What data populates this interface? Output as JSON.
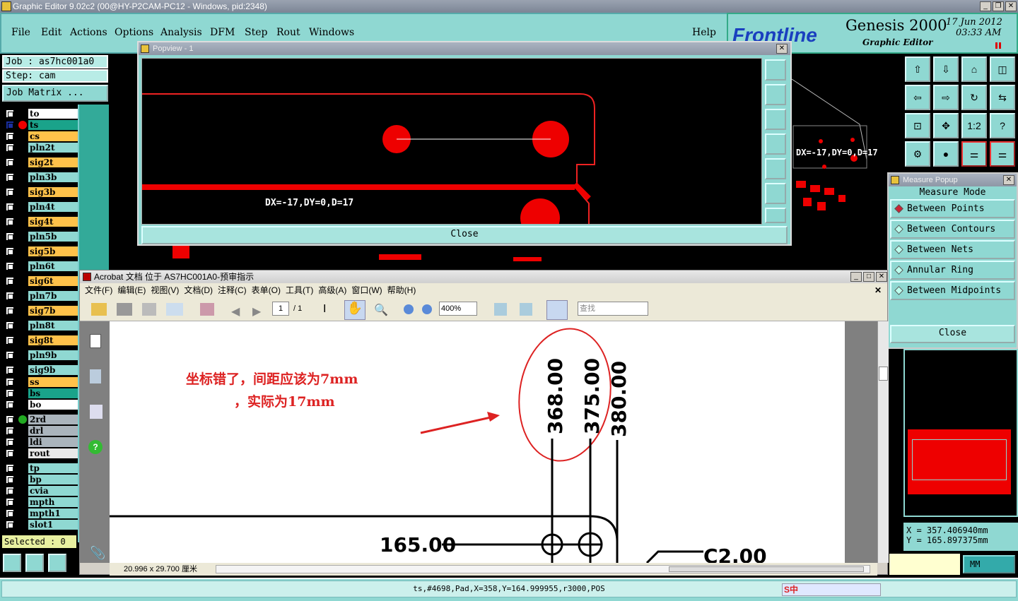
{
  "window": {
    "title": "Graphic Editor 9.02c2 (00@HY-P2CAM-PC12 - Windows, pid:2348)"
  },
  "menu": {
    "items": [
      "File",
      "Edit",
      "Actions",
      "Options",
      "Analysis",
      "DFM",
      "Step",
      "Rout",
      "Windows"
    ],
    "help": "Help"
  },
  "brand": {
    "logo": "Frontline",
    "product": "Genesis 2000",
    "subtitle": "Graphic Editor",
    "date": "17 Jun 2012",
    "time": "03:33 AM"
  },
  "job": {
    "job_label": "Job : as7hc001a0",
    "step_label": "Step: cam",
    "matrix_button": "Job Matrix ..."
  },
  "layers": [
    {
      "name": "to",
      "color": "#ffffff"
    },
    {
      "name": "ts",
      "color": "#1aa38a"
    },
    {
      "name": "cs",
      "color": "#ffc24a"
    },
    {
      "name": "pln2t",
      "color": "#8fd8d2"
    },
    {
      "name": "sig2t",
      "color": "#ffc24a"
    },
    {
      "name": "pln3b",
      "color": "#8fd8d2"
    },
    {
      "name": "sig3b",
      "color": "#ffc24a"
    },
    {
      "name": "pln4t",
      "color": "#8fd8d2"
    },
    {
      "name": "sig4t",
      "color": "#ffc24a"
    },
    {
      "name": "pln5b",
      "color": "#8fd8d2"
    },
    {
      "name": "sig5b",
      "color": "#ffc24a"
    },
    {
      "name": "pln6t",
      "color": "#8fd8d2"
    },
    {
      "name": "sig6t",
      "color": "#ffc24a"
    },
    {
      "name": "pln7b",
      "color": "#8fd8d2"
    },
    {
      "name": "sig7b",
      "color": "#ffc24a"
    },
    {
      "name": "pln8t",
      "color": "#8fd8d2"
    },
    {
      "name": "sig8t",
      "color": "#ffc24a"
    },
    {
      "name": "pln9b",
      "color": "#8fd8d2"
    },
    {
      "name": "sig9b",
      "color": "#8fd8d2"
    },
    {
      "name": "ss",
      "color": "#ffc24a"
    },
    {
      "name": "bs",
      "color": "#1aa38a"
    },
    {
      "name": "bo",
      "color": "#ffffff"
    },
    {
      "name": "2rd",
      "color": "#aab4bc"
    },
    {
      "name": "drl",
      "color": "#aab4bc"
    },
    {
      "name": "ldi",
      "color": "#aab4bc"
    },
    {
      "name": "rout",
      "color": "#e8e8e8"
    },
    {
      "name": "tp",
      "color": "#8fd8d2"
    },
    {
      "name": "bp",
      "color": "#8fd8d2"
    },
    {
      "name": "cvia",
      "color": "#8fd8d2"
    },
    {
      "name": "mpth",
      "color": "#8fd8d2"
    },
    {
      "name": "mpth1",
      "color": "#8fd8d2"
    },
    {
      "name": "slot1",
      "color": "#8fd8d2"
    }
  ],
  "selected": "Selected : 0",
  "popview": {
    "title": "Popview - 1",
    "measure_text": "DX=-17,DY=0,D=17",
    "close": "Close"
  },
  "canvas_label": "DX=-17,DY=0,D=17",
  "measure_popup": {
    "title": "Measure Popup",
    "mode_label": "Measure Mode",
    "options": [
      "Between Points",
      "Between Contours",
      "Between Nets",
      "Annular Ring",
      "Between Midpoints"
    ],
    "close": "Close"
  },
  "coords": {
    "x": "X  = 357.406940mm",
    "y": "Y  = 165.897375mm",
    "unit": "MM"
  },
  "acrobat": {
    "title": "Acrobat 文档 位于 AS7HC001A0-预审指示",
    "menu": [
      "文件(F)",
      "编辑(E)",
      "视图(V)",
      "文档(D)",
      "注释(C)",
      "表单(O)",
      "工具(T)",
      "高级(A)",
      "窗口(W)",
      "帮助(H)"
    ],
    "page": "1",
    "pages": "/ 1",
    "zoom": "400%",
    "search": "查找",
    "page_size": "20.996 x 29.700 厘米"
  },
  "drawing": {
    "note_line1": "坐标错了，间距应该为7mm",
    "note_line2": "，实际为17mm",
    "labels": [
      "368.00",
      "375.00",
      "380.00"
    ],
    "dim1": "165.00",
    "dim2": "C2.00"
  },
  "status": "ts,#4698,Pad,X=358,Y=164.999955,r3000,POS",
  "tray": "S中"
}
